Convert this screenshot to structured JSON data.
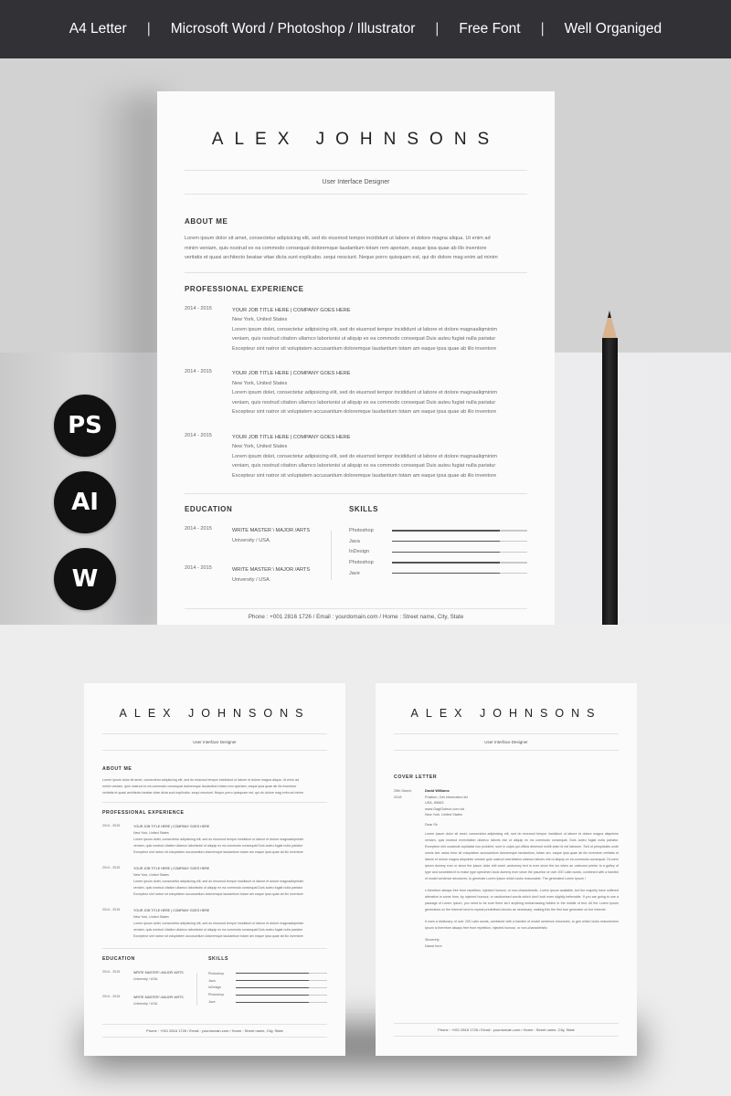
{
  "banner": {
    "items": [
      "A4 Letter",
      "Microsoft Word / Photoshop / Illustrator",
      "Free Font",
      "Well Organiged"
    ],
    "separator": "|"
  },
  "software_badges": [
    "PS",
    "AI",
    "W"
  ],
  "resume": {
    "name": "ALEX JOHNSONS",
    "title": "User Interface Designer",
    "about": {
      "heading": "ABOUT ME",
      "lines": [
        "Lorem ipsum dolor sit amet, consectetur adipisicing elit, sed do eiusmod tempor incididunt ut labore et dolore magna aliqua. Ut enim ad",
        "minim veniam, quis nostrud ex ea commodo consequat doloremque laudantium totam rem aperiam, eaque ipsa quae ab illo inventore",
        "veritatis et quasi architecto beatae vitae dicta sunt explicabo. sequi nesciunt. Neque porro quisquam est, qui do dolore mag enim ad minim"
      ]
    },
    "experience": {
      "heading": "PROFESSIONAL EXPERIENCE",
      "items": [
        {
          "date": "2014 - 2015",
          "title": "YOUR JOB TITLE HERE | COMPANY GOES HERE",
          "location": "New York, United States",
          "lines": [
            "Lorem ipsum dolet, consectetur adipisicing elit, sed do eiusmod tempor incididunt ut labore et dolore magnaaliqminim",
            "veniam, quis nostrud citation ullamco laborisnisi ut aliquip ex ea commodo consequat Duis auteu fugiat nulla pariatur",
            "Excepteur sint natror sit voluptatem accusantium doloremque laudantium totam am eaque ipsa quae ab illo inventore"
          ]
        },
        {
          "date": "2014 - 2015",
          "title": "YOUR JOB TITLE HERE | COMPANY GOES HERE",
          "location": "New York, United States",
          "lines": [
            "Lorem ipsum dolet, consectetur adipisicing elit, sed do eiusmod tempor incididunt ut labore et dolore magnaaliqminim",
            "veniam, quis nostrud citation ullamco laborisnisi ut aliquip ex ea commodo consequat Duis auteu fugiat nulla pariatur",
            "Excepteur sint natror sit voluptatem accusantium doloremque laudantium totam am eaque ipsa quae ab illo inventore"
          ]
        },
        {
          "date": "2014 - 2015",
          "title": "YOUR JOB TITLE HERE | COMPANY GOES HERE",
          "location": "New York, United States",
          "lines": [
            "Lorem ipsum dolet, consectetur adipisicing elit, sed do eiusmod tempor incididunt ut labore et dolore magnaaliqminim",
            "veniam, quis nostrud citation ullamco laborisnisi ut aliquip ex ea commodo consequat Duis auteu fugiat nulla pariatur",
            "Excepteur sint natror sit voluptatem accusantium doloremque laudantium totam am eaque ipsa quae ab illo inventore"
          ]
        }
      ]
    },
    "education": {
      "heading": "EDUCATION",
      "items": [
        {
          "date": "2014 - 2015",
          "degree": "WRITE MASTER \\ MAJOR /ARTS",
          "school": "University / USA."
        },
        {
          "date": "2014 - 2015",
          "degree": "WRITE MASTER \\ MAJOR /ARTS",
          "school": "University / USA."
        }
      ]
    },
    "skills": {
      "heading": "SKILLS",
      "items": [
        {
          "name": "Photoshop",
          "level": 0.8
        },
        {
          "name": "Java",
          "level": 0.8
        },
        {
          "name": "InDesign",
          "level": 0.8
        },
        {
          "name": "Photoshop",
          "level": 0.8
        },
        {
          "name": "Jave",
          "level": 0.8
        }
      ]
    },
    "footer": "Phone : +001 2816 1726  /  Email : yourdomain.com  /  Home : Street name, City, State"
  },
  "cover_letter": {
    "name": "ALEX JOHNSONS",
    "title": "User Interface Designer",
    "heading": "COVER LETTER",
    "date_lines": [
      "25th March,",
      "2018"
    ],
    "recipient": [
      "David Williams",
      "Position, Get information ltd",
      "USA, 85663",
      "www.GagiGotech.com.bd",
      "New York, United States"
    ],
    "salutation": "Dear Sir",
    "paragraphs": [
      "Lorem ipsum dolor sit amet, consectetur adipisicing elit, sed do eiusmod tempor incididunt ut labore et dolore magna aliqminim veniam, quis nostrud exercitation ullamco laboris nisi ut aliquip ex ea commodo consequat. Duis auteu fugiat nulla pariatur. Excepteur sint occaecat cupidatat non proident, sunt in culpa qui officia deserunt mollit anim id est laborum. Sed ut perspiciatis unde omnis iste natus error sit voluptatem accusantium doloremque laudantium, totam am, eaque ipsa quae ab illo inventore veritatis et labore et dolore magna aliqminim veniam quis nostrud exercitation ullamco laboris nisi ut aliquip ex ea commodo consequat. DLorem ipsum dummy ever or since the ipsum dolor shit amet, andummy text is ever since the loo when an unknown printer to a galley of type and scrambled it to make type specimen book dummy ever since the ipsumlor of over 200 Latin words, combined with a handful of model sentence structures, to generate Lorem Ipsum which looks reasonable. The generated Lorem Ipsum i",
      "s therefore always free from repetition, injected humour, or non-characteristic. Lorem Ipsum available, but the majority have suffered alteration in some form, by injected humour, or randomised words which don't look even slightly believable. If you are going to use a passage of Lorem Ipsum, you need to be sure there isn't anything embarrassing hidden in the middle of text. All the Lorem Ipsum generators on the Internet tend to repeat predefined chunks as necessary, making this the first true generator on the Internet.",
      "It uses a dictionary of over 200 Latin words, combined with a handful of model sentence structures, to gen which looks reasonlorem Ipsum is therefore always free from repetition, injected humour, or non-characteristic"
    ],
    "closing": [
      "Sincerely",
      "Name here"
    ],
    "footer": "Phone : +001 2816 1726  /  Email : yourdomain.com  /  Home : Street name, City, State"
  }
}
